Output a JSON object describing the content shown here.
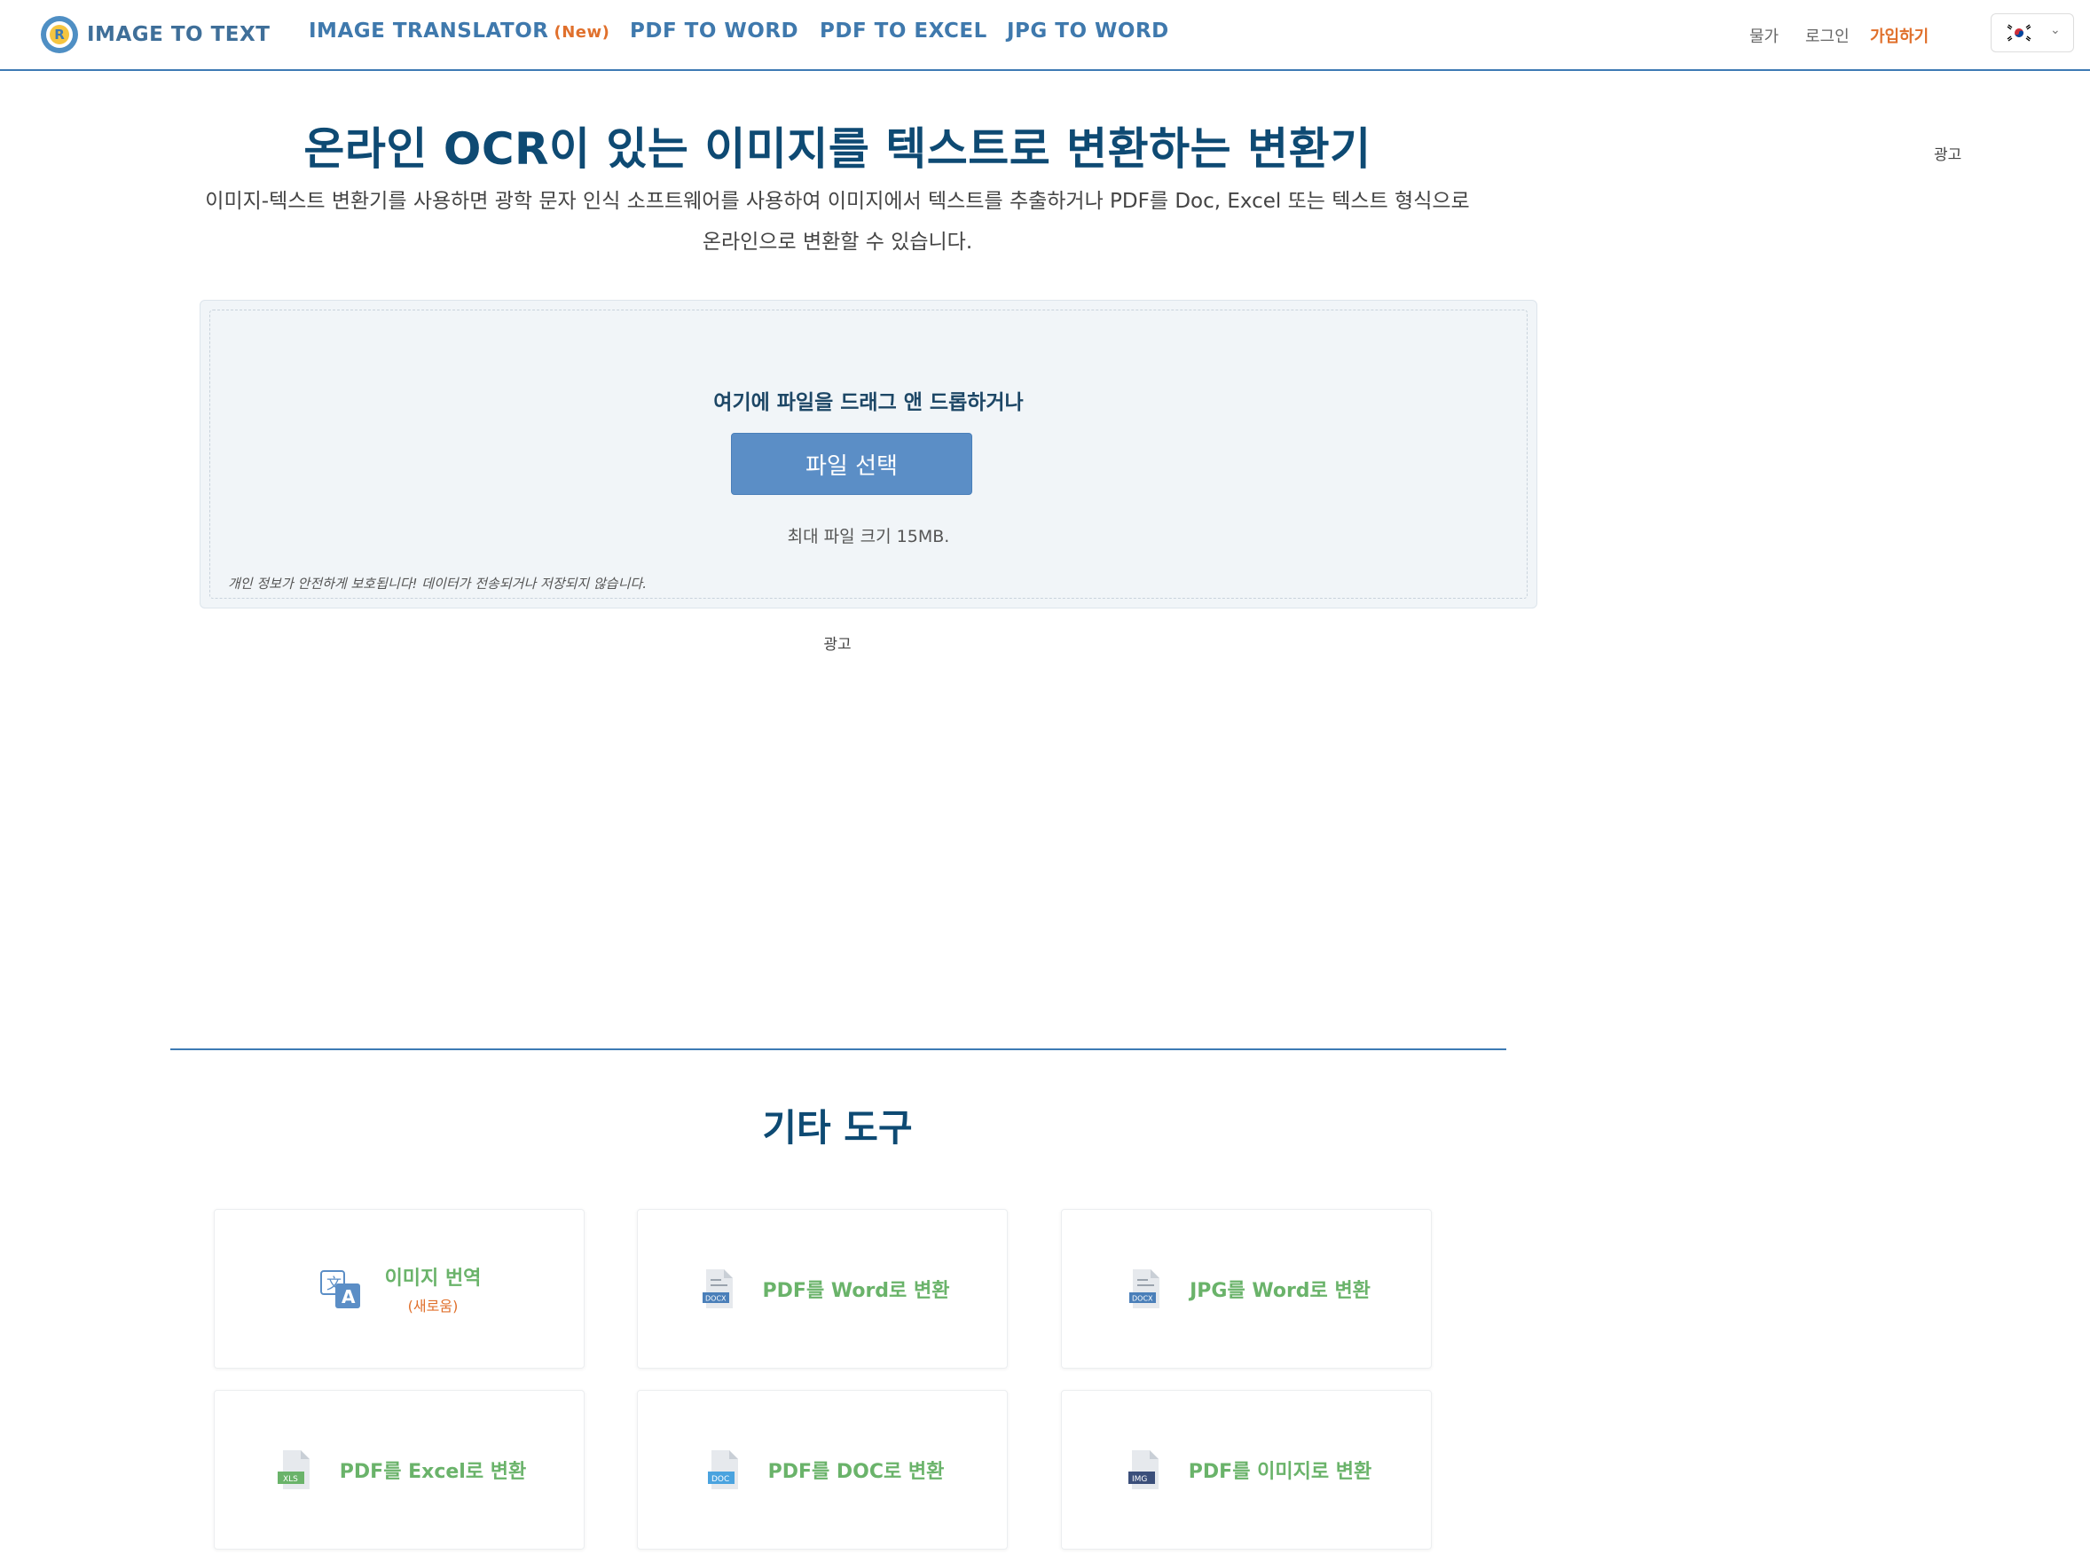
{
  "header": {
    "logo_text": "IMAGE TO TEXT",
    "logo_letter": "R",
    "nav": [
      {
        "label": "IMAGE TRANSLATOR",
        "badge": "(New)"
      },
      {
        "label": "PDF TO WORD"
      },
      {
        "label": "PDF TO EXCEL"
      },
      {
        "label": "JPG TO WORD"
      }
    ],
    "pricing": "물가",
    "login": "로그인",
    "signup": "가입하기",
    "language_icon": "korea-flag-icon"
  },
  "hero": {
    "title": "온라인 OCR이 있는 이미지를 텍스트로 변환하는 변환기",
    "description_line1": "이미지-텍스트 변환기를 사용하면 광학 문자 인식 소프트웨어를 사용하여 이미지에서 텍스트를 추출하거나 PDF를 Doc, Excel 또는 텍스트 형식으로",
    "description_line2": "온라인으로 변환할 수 있습니다.",
    "ad_label_right": "광고"
  },
  "upload": {
    "drop_label": "여기에 파일을 드래그 앤 드롭하거나",
    "button_label": "파일 선택",
    "max_size": "최대 파일 크기 15MB.",
    "privacy": "개인 정보가 안전하게 보호됩니다! 데이터가 전송되거나 저장되지 않습니다."
  },
  "ad_label_center": "광고",
  "tools": {
    "title": "기타 도구",
    "items": [
      {
        "label": "이미지 번역",
        "sub": "(새로움)",
        "icon": "translate-icon",
        "color": "#5b8ec6"
      },
      {
        "label": "PDF를 Word로 변환",
        "icon": "docx-file-icon",
        "color": "#4a7fb9"
      },
      {
        "label": "JPG를 Word로 변환",
        "icon": "docx-file-icon",
        "color": "#4a7fb9"
      },
      {
        "label": "PDF를 Excel로 변환",
        "icon": "xls-file-icon",
        "color": "#6ab36a"
      },
      {
        "label": "PDF를 DOC로 변환",
        "icon": "doc-file-icon",
        "color": "#4aa3df"
      },
      {
        "label": "PDF를 이미지로 변환",
        "icon": "img-file-icon",
        "color": "#3b4f7a"
      }
    ]
  },
  "colors": {
    "brand_blue": "#3d7ab4",
    "title_navy": "#0e4a73",
    "accent_orange": "#e0702c",
    "tool_green": "#6ab36a"
  }
}
